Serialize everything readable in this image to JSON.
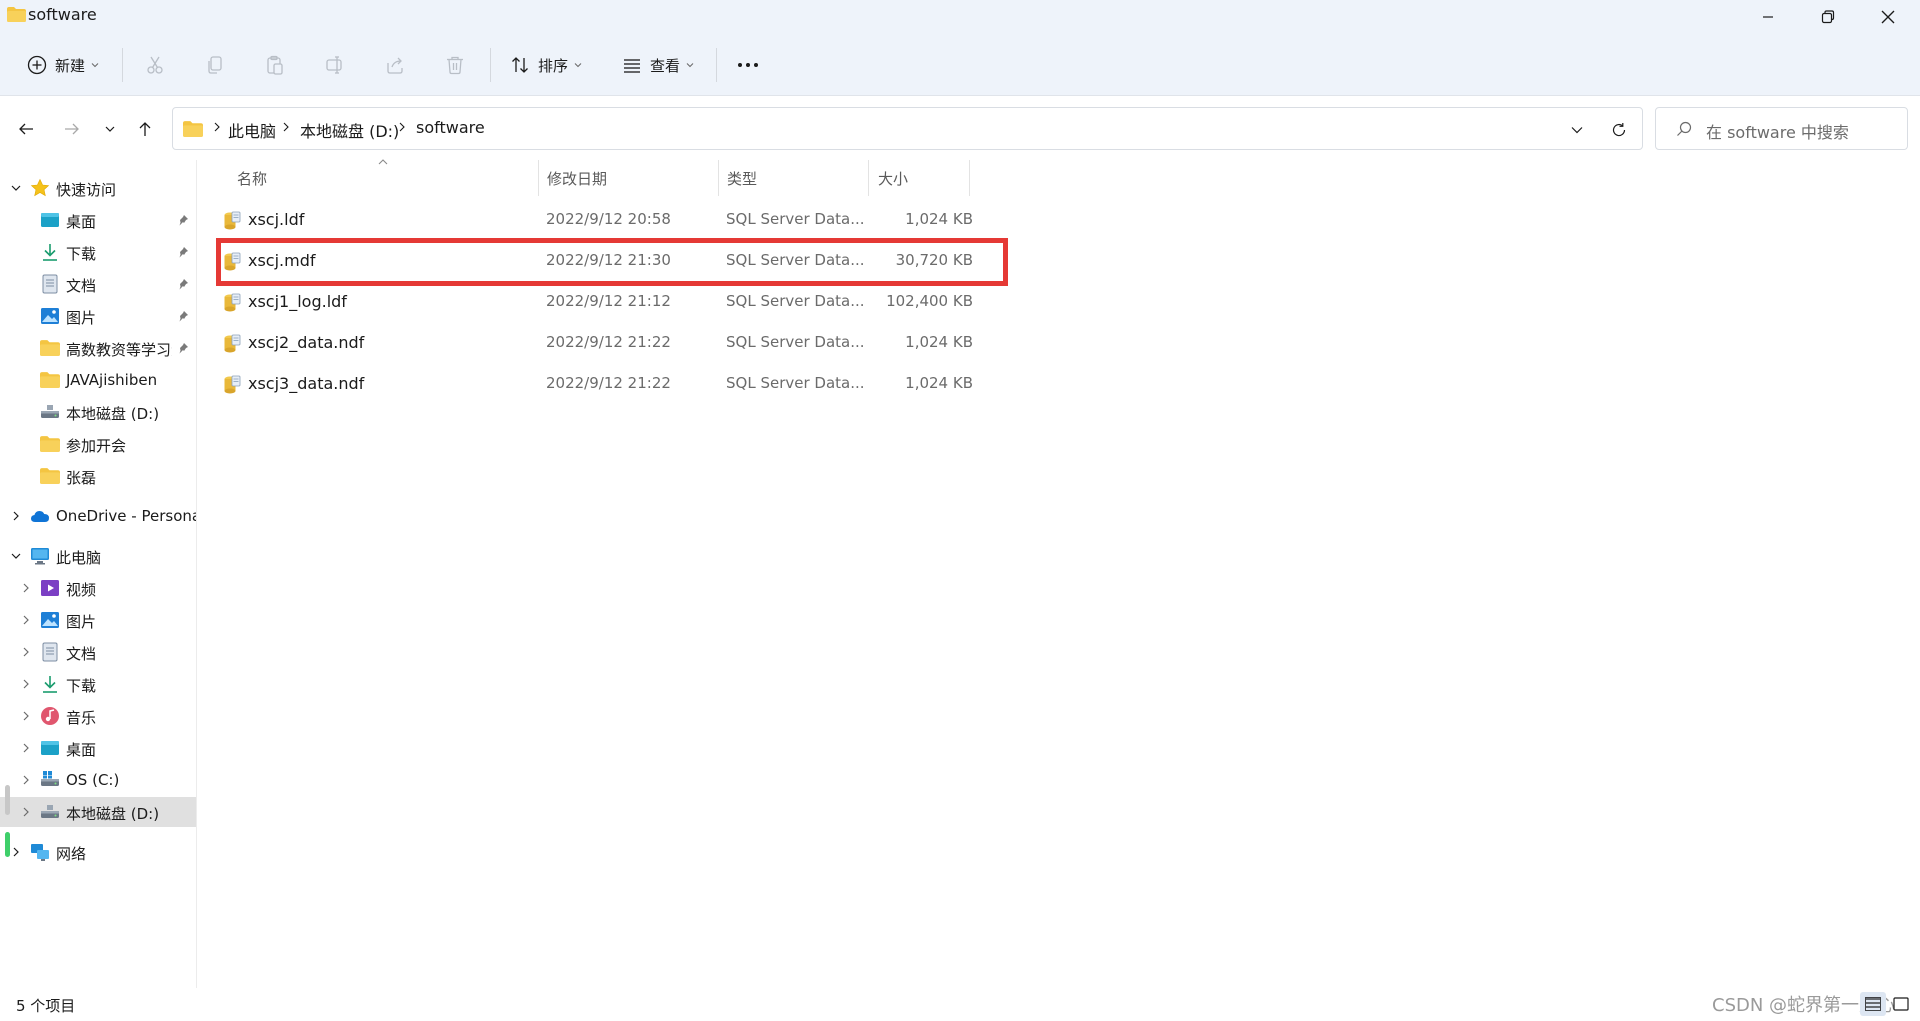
{
  "window": {
    "title": "software",
    "minimize_icon": "minimize-icon",
    "maximize_icon": "restore-icon",
    "close_icon": "close-icon"
  },
  "toolbar": {
    "new_label": "新建",
    "sort_label": "排序",
    "view_label": "查看",
    "icons": [
      "cut-icon",
      "copy-icon",
      "paste-icon",
      "rename-icon",
      "share-icon",
      "delete-icon",
      "more-icon"
    ]
  },
  "address": {
    "crumbs": [
      "此电脑",
      "本地磁盘 (D:)",
      "software"
    ]
  },
  "search": {
    "placeholder": "在 software 中搜索"
  },
  "sidebar": {
    "quick_access": "快速访问",
    "quick_items": [
      {
        "label": "桌面",
        "icon": "desktop-icon",
        "pinned": true
      },
      {
        "label": "下载",
        "icon": "download-icon",
        "pinned": true
      },
      {
        "label": "文档",
        "icon": "document-icon",
        "pinned": true
      },
      {
        "label": "图片",
        "icon": "picture-icon",
        "pinned": true
      },
      {
        "label": "高数教资等学习资料",
        "icon": "folder-icon",
        "pinned": true
      },
      {
        "label": "JAVAjishiben",
        "icon": "folder-icon",
        "pinned": false
      },
      {
        "label": "本地磁盘 (D:)",
        "icon": "drive-icon",
        "pinned": false
      },
      {
        "label": "参加开会",
        "icon": "folder-icon",
        "pinned": false
      },
      {
        "label": "张磊",
        "icon": "folder-icon",
        "pinned": false
      }
    ],
    "onedrive": "OneDrive - Personal",
    "this_pc": "此电脑",
    "pc_items": [
      {
        "label": "视频",
        "icon": "video-icon"
      },
      {
        "label": "图片",
        "icon": "picture-icon"
      },
      {
        "label": "文档",
        "icon": "document-icon"
      },
      {
        "label": "下载",
        "icon": "download-icon"
      },
      {
        "label": "音乐",
        "icon": "music-icon"
      },
      {
        "label": "桌面",
        "icon": "desktop-icon"
      },
      {
        "label": "OS (C:)",
        "icon": "os-drive-icon"
      },
      {
        "label": "本地磁盘 (D:)",
        "icon": "drive-icon"
      }
    ],
    "network": "网络"
  },
  "columns": {
    "name": "名称",
    "date": "修改日期",
    "type": "类型",
    "size": "大小"
  },
  "files": [
    {
      "name": "xscj.ldf",
      "date": "2022/9/12 20:58",
      "type": "SQL Server Data...",
      "size": "1,024 KB"
    },
    {
      "name": "xscj.mdf",
      "date": "2022/9/12 21:30",
      "type": "SQL Server Data...",
      "size": "30,720 KB",
      "highlighted": true
    },
    {
      "name": "xscj1_log.ldf",
      "date": "2022/9/12 21:12",
      "type": "SQL Server Data...",
      "size": "102,400 KB"
    },
    {
      "name": "xscj2_data.ndf",
      "date": "2022/9/12 21:22",
      "type": "SQL Server Data...",
      "size": "1,024 KB"
    },
    {
      "name": "xscj3_data.ndf",
      "date": "2022/9/12 21:22",
      "type": "SQL Server Data...",
      "size": "1,024 KB"
    }
  ],
  "status": {
    "item_count": "5 个项目"
  },
  "watermark": "CSDN @蛇界第一冠心",
  "colors": {
    "highlight_border": "#e53935",
    "chrome_bg": "#eef3fa",
    "folder_yellow": "#f4c542"
  }
}
